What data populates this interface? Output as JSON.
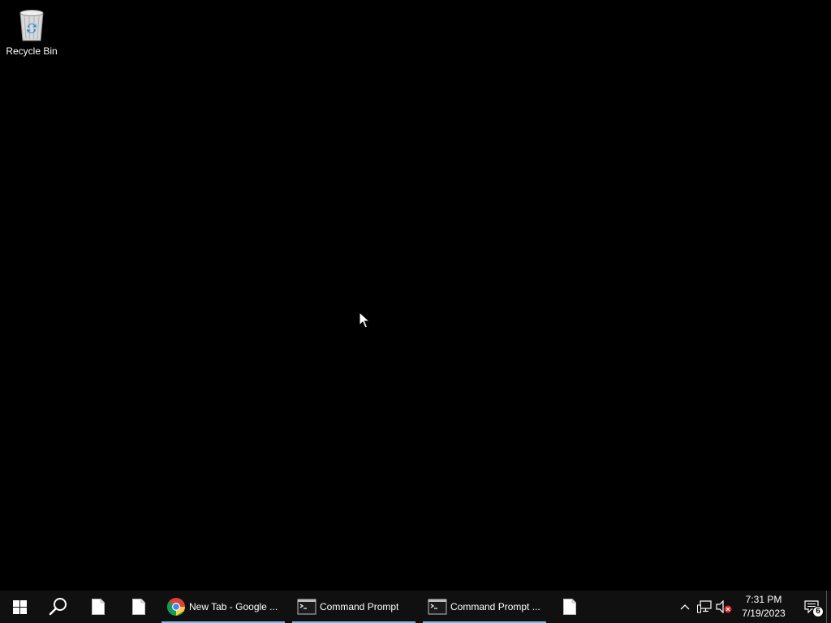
{
  "desktop": {
    "icons": [
      {
        "label": "Recycle Bin",
        "icon": "recycle-bin-icon"
      }
    ]
  },
  "taskbar": {
    "start_icon": "windows-logo-icon",
    "search_icon": "search-icon",
    "pinned": [
      {
        "icon": "blank-file-icon"
      },
      {
        "icon": "blank-file-icon"
      }
    ],
    "apps": [
      {
        "label": "New Tab - Google ...",
        "icon": "chrome-icon",
        "active": true
      },
      {
        "label": "Command Prompt",
        "icon": "command-prompt-icon",
        "active": true
      },
      {
        "label": "Command Prompt ...",
        "icon": "command-prompt-icon",
        "active": true
      }
    ],
    "trailing_pinned": {
      "icon": "blank-file-icon"
    },
    "tray": {
      "chevron_icon": "chevron-up-icon",
      "network_icon": "network-icon",
      "volume_icon": "volume-muted-icon",
      "time": "7:31 PM",
      "date": "7/19/2023",
      "notifications_icon": "notifications-icon",
      "notification_count": "6"
    }
  },
  "colors": {
    "desktop_bg": "#000000",
    "taskbar_bg": "#101010",
    "active_underline": "#76b9ed"
  }
}
